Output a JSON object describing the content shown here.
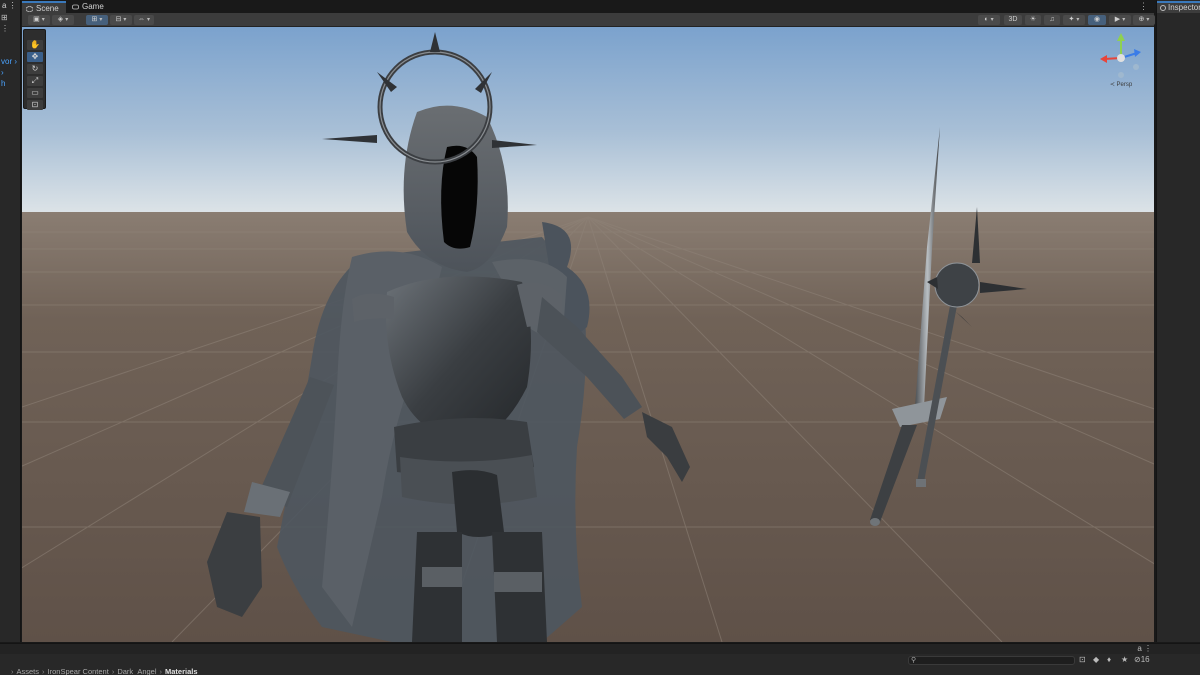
{
  "tabs": [
    {
      "label": "Scene",
      "active": true
    },
    {
      "label": "Game",
      "active": false
    }
  ],
  "tab_more": "⋮",
  "left_panel": {
    "top_label": "a ⋮",
    "rows": [
      {
        "label": "⊞",
        "selected": false
      },
      {
        "label": "⋮",
        "selected": false
      },
      {
        "label": "",
        "selected": false
      },
      {
        "label": "",
        "selected": false
      },
      {
        "label": "vor ›",
        "selected": true
      },
      {
        "label": "›",
        "selected": true
      },
      {
        "label": "h",
        "selected": true
      }
    ]
  },
  "scene_toolbar": {
    "left": [
      {
        "name": "draw-mode",
        "label": "▣"
      },
      {
        "name": "render-mode",
        "label": "◈"
      },
      {
        "name": "transform-handle",
        "label": "⊞",
        "active": true
      },
      {
        "name": "grid-snap",
        "label": "⊟"
      },
      {
        "name": "increment-snap",
        "label": "⇔"
      }
    ],
    "right": [
      {
        "name": "shading",
        "label": "◐"
      },
      {
        "name": "2d-toggle",
        "label": "3D"
      },
      {
        "name": "lighting",
        "label": "☀"
      },
      {
        "name": "audio",
        "label": "♫"
      },
      {
        "name": "effects",
        "label": "✦"
      },
      {
        "name": "hidden-objects",
        "label": "◉",
        "active": true
      },
      {
        "name": "camera",
        "label": "▶"
      },
      {
        "name": "gizmos",
        "label": "⊕"
      }
    ]
  },
  "tools": [
    {
      "name": "hand-tool",
      "label": "✋"
    },
    {
      "name": "move-tool",
      "label": "✥",
      "active": true
    },
    {
      "name": "rotate-tool",
      "label": "↻"
    },
    {
      "name": "scale-tool",
      "label": "⤢"
    },
    {
      "name": "rect-tool",
      "label": "▭"
    },
    {
      "name": "transform-tool",
      "label": "⊡"
    }
  ],
  "gizmo": {
    "label": "≺ Persp",
    "x_color": "#e8443a",
    "y_color": "#8fd14f",
    "z_color": "#3a7ce8"
  },
  "inspector": {
    "tab_label": "Inspector"
  },
  "bottom": {
    "top_icons": "a ⋮",
    "search_placeholder": "",
    "tool_icons": [
      "⊡",
      "◆",
      "♦",
      "★",
      "⊘16"
    ],
    "breadcrumb": [
      "Assets",
      "IronSpear Content",
      "Dark_Angel",
      "Materials"
    ]
  },
  "colors": {
    "accent": "#3a79bb",
    "sky_top": "#7da4cf",
    "sky_horizon": "#d8e0e4",
    "ground": "#6b5c52"
  }
}
